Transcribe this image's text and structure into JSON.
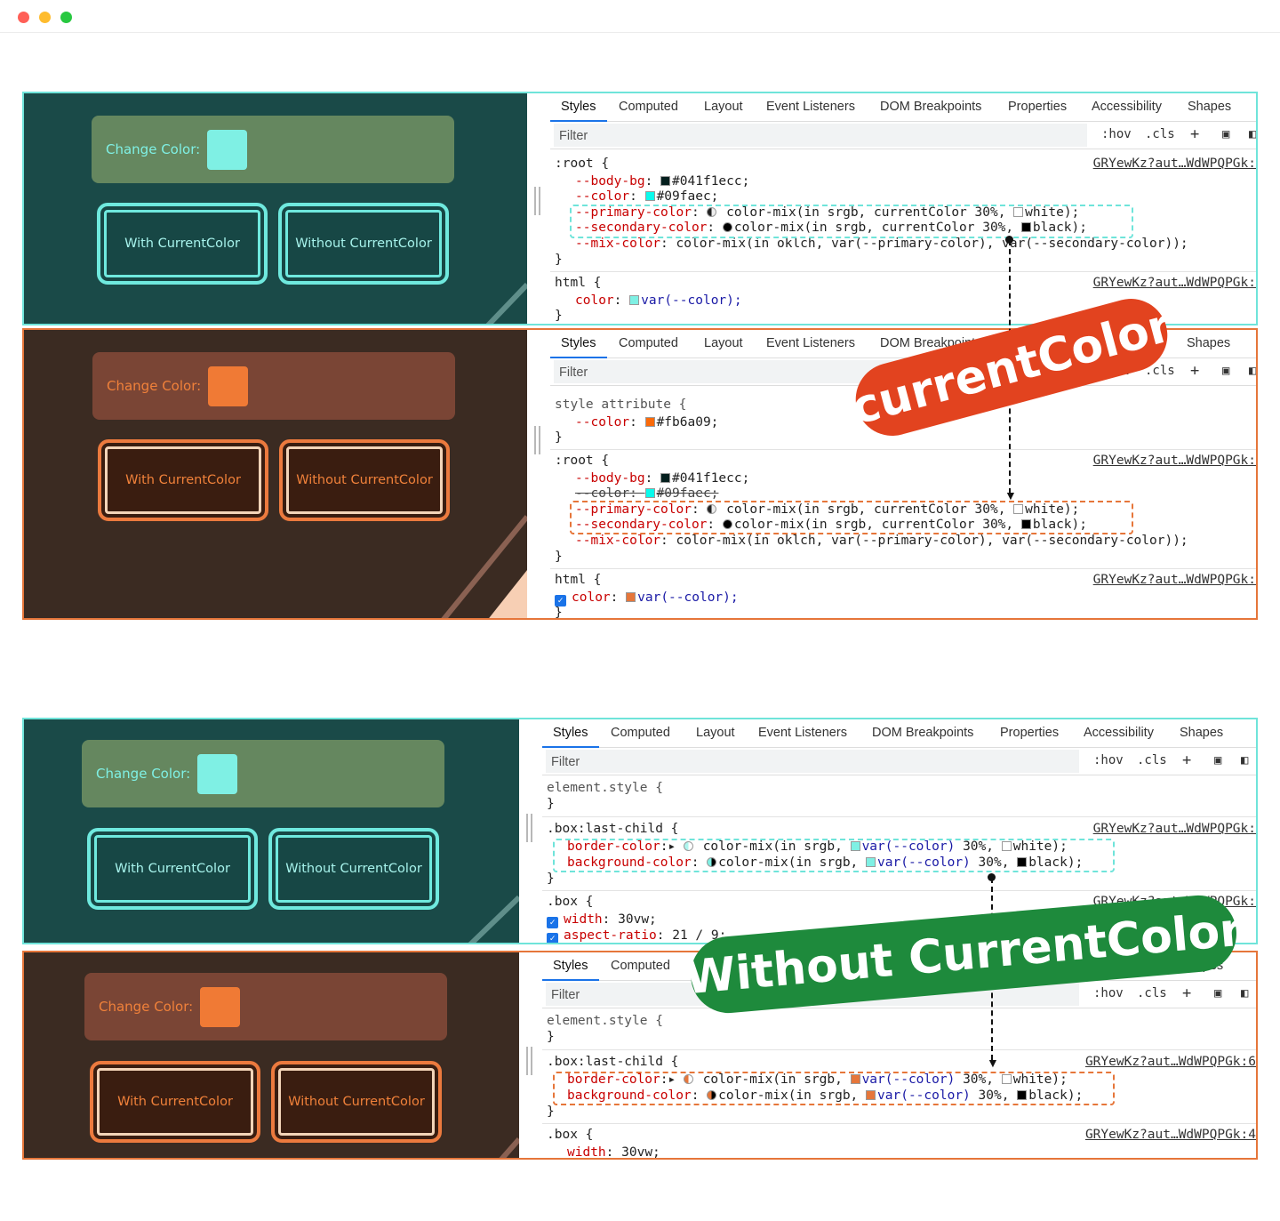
{
  "window": {
    "traffic_lights": [
      "#ff5f57",
      "#febc2e",
      "#28c840"
    ]
  },
  "colors": {
    "teal_accent": "#6fe4da",
    "orange_accent": "#e6763a",
    "teal_bg": "#1a4a48",
    "brown_bg": "#3b2b22"
  },
  "demo": {
    "change_color_label": "Change Color:",
    "with_label": "With CurrentColor",
    "without_label": "Without CurrentColor",
    "teal_swatch": "#7ff0e4",
    "orange_swatch": "#f07a35"
  },
  "devtools": {
    "tabs": [
      "Styles",
      "Computed",
      "Layout",
      "Event Listeners",
      "DOM Breakpoints",
      "Properties",
      "Accessibility",
      "Shapes"
    ],
    "filter_placeholder": "Filter",
    "hov": ":hov",
    "cls": ".cls",
    "source": "GRYewKz?aut…WdWPQPGk:",
    "source_clipped": "GRYewKz?aut…WdWPQPGk:",
    "source_6": "GRYewKz?aut…WdWPQPGk:6",
    "source_4": "GRYewKz?aut…WdWPQPGk:4"
  },
  "code": {
    "root_open": ":root {",
    "body_bg_prop": "--body-bg",
    "body_bg_val": "#041f1ecc;",
    "color_prop": "--color",
    "color_val_teal": "#09faec;",
    "primary_prop": "--primary-color",
    "primary_val_a": "color-mix(in srgb, currentColor 30%, ",
    "primary_val_b": "white);",
    "secondary_prop": "--secondary-color",
    "secondary_val_a": "color-mix(in srgb, currentColor 30%, ",
    "secondary_val_b": "black);",
    "mix_prop": "--mix-color",
    "mix_val": "color-mix(in oklch, var(--primary-color), var(--secondary-color));",
    "close": "}",
    "html_open": "html {",
    "html_color_prop": "color",
    "var_color": "var(--color);",
    "style_attr_open": "style attribute {",
    "color_val_orange": "#fb6a09;",
    "element_style_open": "element.style {",
    "box_last_open": ".box:last-child {",
    "border_color_prop": "border-color",
    "border_val_a": "color-mix(in srgb, ",
    "border_val_var": "var(--color)",
    "border_val_b": " 30%, ",
    "border_val_c": "white);",
    "bg_color_prop": "background-color",
    "bg_val_c": "black);",
    "box_open": ".box {",
    "width_prop": "width",
    "width_val": "30vw;",
    "aspect_prop": "aspect-ratio",
    "aspect_val": "21 / 9;"
  },
  "annotations": {
    "current_color": "currentColor",
    "without_current_color": "Without CurrentColor",
    "current_color_badge_bg": "#e2431f",
    "without_badge_bg": "#1e8a3c"
  }
}
